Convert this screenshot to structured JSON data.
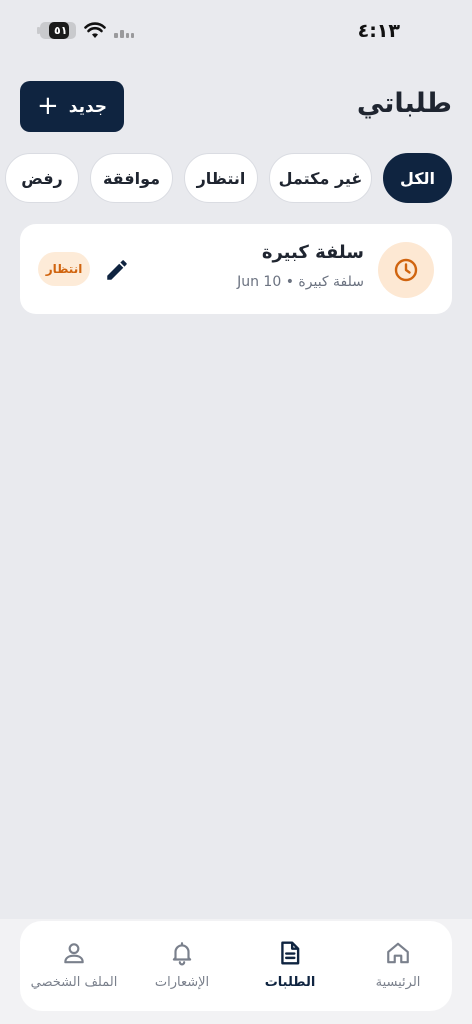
{
  "status_bar": {
    "time": "٤:١٣",
    "battery": "٥١"
  },
  "header": {
    "title": "طلباتي",
    "new_button_label": "جديد"
  },
  "filters": [
    {
      "label": "الكل",
      "active": true
    },
    {
      "label": "غير مكتمل",
      "active": false
    },
    {
      "label": "انتظار",
      "active": false
    },
    {
      "label": "موافقة",
      "active": false
    },
    {
      "label": "رفض",
      "active": false
    }
  ],
  "requests": [
    {
      "title": "سلفة كبيرة",
      "meta": "Jun 10 • سلفة كبيرة",
      "status": "انتظار",
      "icon": "clock-icon"
    }
  ],
  "bottom_nav": [
    {
      "label": "الرئيسية",
      "icon": "home-icon",
      "active": false
    },
    {
      "label": "الطلبات",
      "icon": "document-icon",
      "active": true
    },
    {
      "label": "الإشعارات",
      "icon": "bell-icon",
      "active": false
    },
    {
      "label": "الملف الشخصي",
      "icon": "profile-icon",
      "active": false
    }
  ],
  "colors": {
    "background": "#e9eaee",
    "primary": "#0f2440",
    "pending": "#d0640f",
    "pending_bg": "#fdebd8"
  }
}
